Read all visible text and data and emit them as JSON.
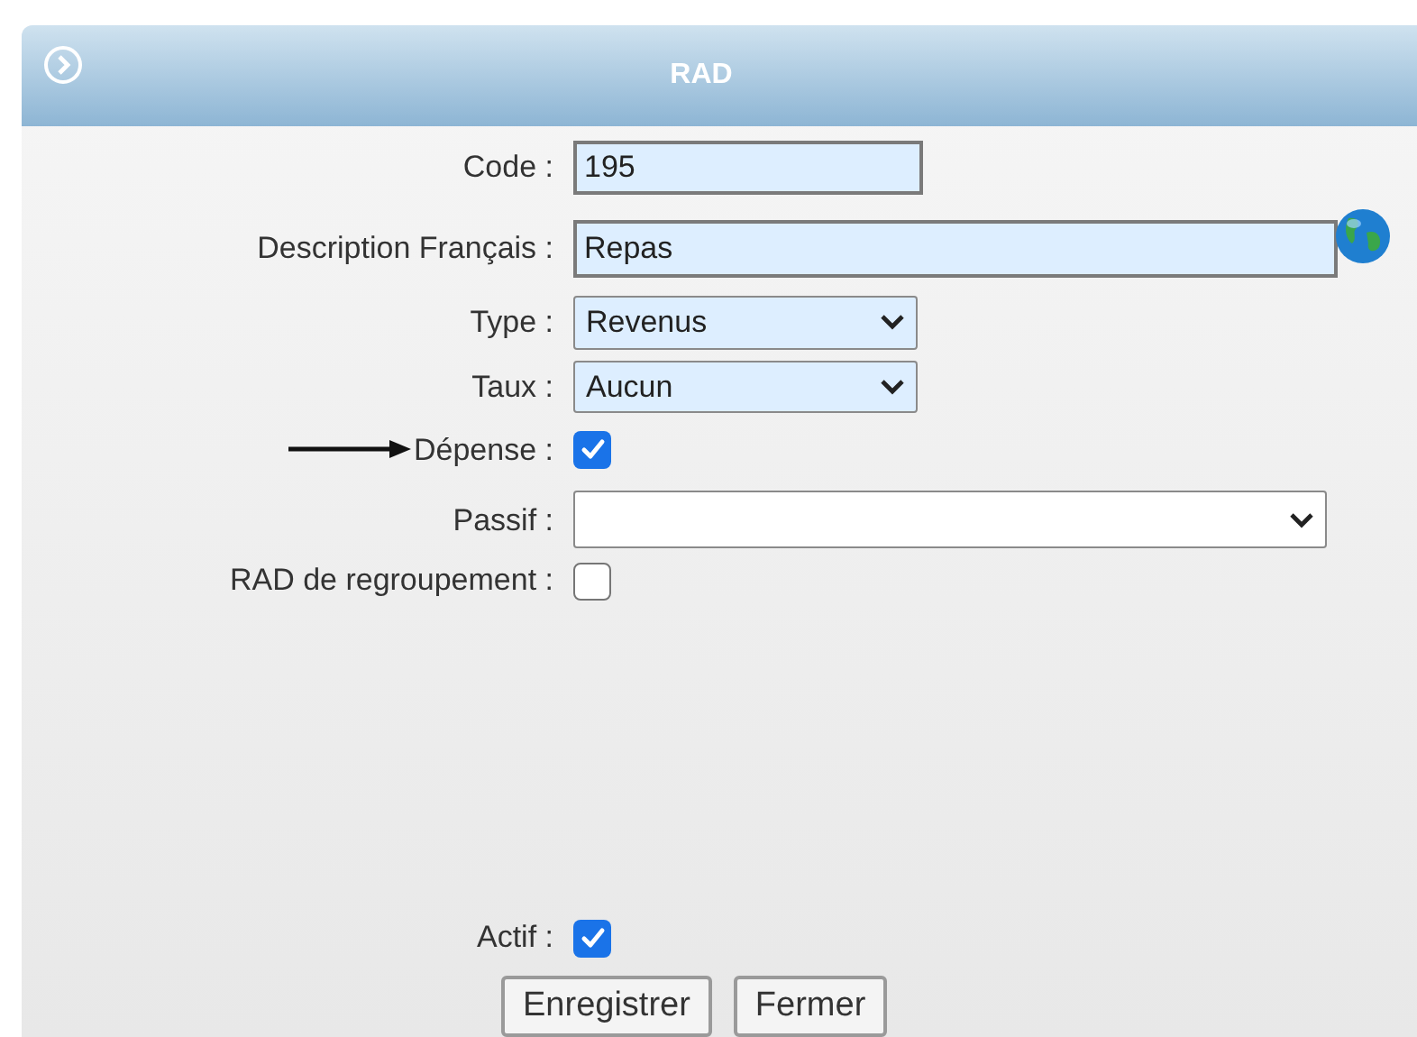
{
  "window": {
    "title": "RAD"
  },
  "fields": [
    {
      "label": "Code :",
      "kind": "text",
      "value": "195",
      "arrow": false,
      "globe": false
    },
    {
      "label": "Description Français :",
      "kind": "text",
      "value": "Repas",
      "arrow": false,
      "globe": true
    },
    {
      "label": "Type :",
      "kind": "select",
      "value": "Revenus",
      "arrow": false,
      "globe": false
    },
    {
      "label": "Taux :",
      "kind": "select",
      "value": "Aucun",
      "arrow": false,
      "globe": false
    },
    {
      "label": "Dépense :",
      "kind": "checkbox",
      "checked": true,
      "arrow": true,
      "globe": false
    },
    {
      "label": "Passif :",
      "kind": "select",
      "arrow": false,
      "globe": false
    },
    {
      "label": "RAD de regroupement :",
      "kind": "checkbox",
      "checked": false,
      "arrow": false,
      "globe": false
    }
  ],
  "actif": {
    "label": "Actif :",
    "checked": true
  },
  "buttons": [
    "Enregistrer",
    "Fermer"
  ]
}
